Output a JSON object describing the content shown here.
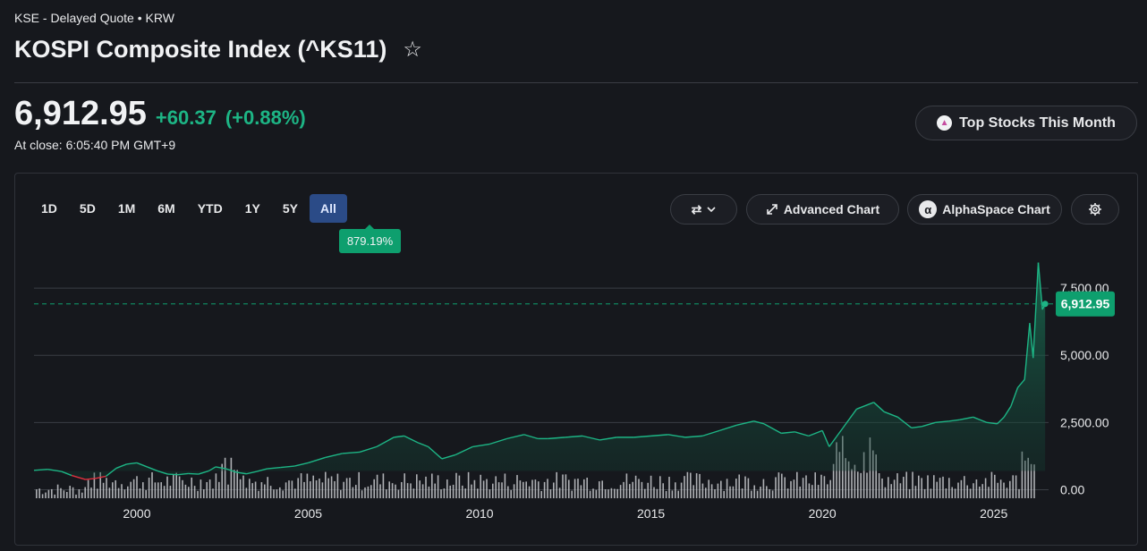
{
  "header": {
    "exchange_line": "KSE - Delayed Quote • KRW",
    "title": "KOSPI Composite Index (^KS11)",
    "star_icon": "☆"
  },
  "quote": {
    "price": "6,912.95",
    "change": "+60.37",
    "change_pct": "(+0.88%)",
    "close_time": "At close: 6:05:40 PM GMT+9"
  },
  "promo": {
    "label": "Top Stocks This Month",
    "icon": "bull-icon"
  },
  "toolbar": {
    "ranges": [
      "1D",
      "5D",
      "1M",
      "6M",
      "YTD",
      "1Y",
      "5Y",
      "All"
    ],
    "active_range": "All",
    "range_return": "879.19%",
    "chart_type_icon": "⇄",
    "advanced_chart": "Advanced Chart",
    "alphaspace_chart": "AlphaSpace Chart",
    "alpha_glyph": "α"
  },
  "colors": {
    "up": "#1db585",
    "down": "#e0303f",
    "accent": "#0e9f6e",
    "active_range": "#2b4b87",
    "volume": "#c9cbcf"
  },
  "chart_data": {
    "type": "area",
    "ylim": [
      -350,
      8800
    ],
    "yticks": [
      0,
      2500,
      5000,
      7500
    ],
    "ytick_labels": [
      "0.00",
      "2,500.00",
      "5,000.00",
      "7,500.00"
    ],
    "xlim": [
      1997,
      2026.6
    ],
    "xticks": [
      2000,
      2005,
      2010,
      2015,
      2020,
      2025
    ],
    "xtick_labels": [
      "2000",
      "2005",
      "2010",
      "2015",
      "2020",
      "2025"
    ],
    "last_value": 6912.95,
    "last_value_label": "6,912.95",
    "grid": true,
    "series": [
      {
        "x": [
          1997,
          1997.4,
          1997.8,
          1998.1,
          1998.5,
          1998.8,
          1999.1,
          1999.4,
          1999.7,
          2000,
          2000.3,
          2000.6,
          2000.9,
          2001.2,
          2001.5,
          2001.8,
          2002.1,
          2002.3,
          2002.6,
          2002.9,
          2003.2,
          2003.5,
          2003.8,
          2004.2,
          2004.6,
          2005,
          2005.5,
          2006,
          2006.5,
          2007,
          2007.5,
          2007.8,
          2008.2,
          2008.5,
          2008.9,
          2009.3,
          2009.8,
          2010.3,
          2010.8,
          2011.3,
          2011.7,
          2012,
          2012.5,
          2013,
          2013.5,
          2014,
          2014.5,
          2015,
          2015.5,
          2016,
          2016.5,
          2017,
          2017.5,
          2018,
          2018.3,
          2018.8,
          2019.2,
          2019.6,
          2020,
          2020.2,
          2020.6,
          2021,
          2021.5,
          2021.8,
          2022.2,
          2022.6,
          2022.9,
          2023.3,
          2023.7,
          2024,
          2024.4,
          2024.8,
          2025.1,
          2025.3,
          2025.5,
          2025.7,
          2025.9,
          2026.05,
          2026.15,
          2026.3,
          2026.42,
          2026.5
        ],
        "y": [
          720,
          760,
          680,
          530,
          380,
          420,
          500,
          800,
          950,
          1000,
          850,
          700,
          580,
          560,
          600,
          580,
          700,
          850,
          780,
          650,
          590,
          680,
          780,
          830,
          880,
          1000,
          1200,
          1350,
          1400,
          1600,
          1950,
          2000,
          1750,
          1600,
          1150,
          1300,
          1600,
          1700,
          1900,
          2050,
          1900,
          1900,
          1950,
          2000,
          1850,
          1950,
          1950,
          2000,
          2050,
          1950,
          2000,
          2200,
          2400,
          2550,
          2450,
          2100,
          2150,
          2000,
          2200,
          1600,
          2300,
          3000,
          3250,
          2900,
          2700,
          2300,
          2350,
          2500,
          2550,
          2600,
          2700,
          2500,
          2450,
          2700,
          3100,
          3800,
          4100,
          6200,
          4900,
          8450,
          6700,
          6912.95
        ]
      }
    ],
    "volume_note": "volume bars in lower band"
  }
}
